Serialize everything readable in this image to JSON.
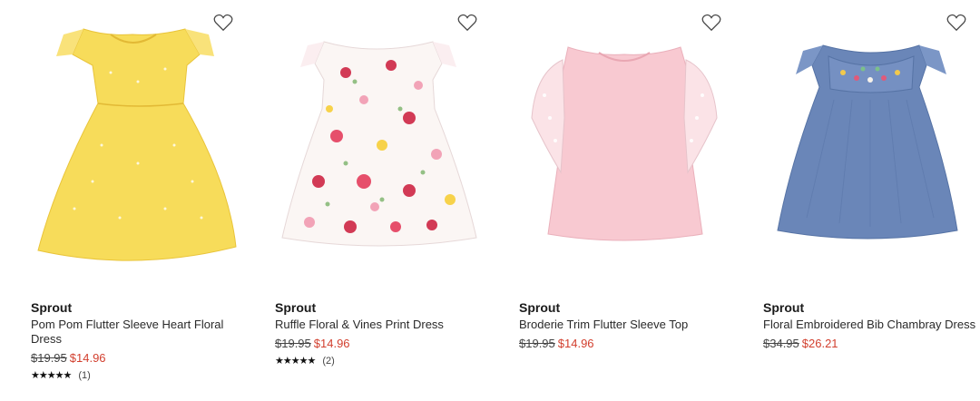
{
  "products": [
    {
      "brand": "Sprout",
      "title": "Pom Pom Flutter Sleeve Heart Floral Dress",
      "was_price": "$19.95",
      "sale_price": "$14.96",
      "stars": "★★★★★",
      "review_count": "(1)",
      "image_icon": "yellow-dress-icon"
    },
    {
      "brand": "Sprout",
      "title": "Ruffle Floral & Vines Print Dress",
      "was_price": "$19.95",
      "sale_price": "$14.96",
      "stars": "★★★★★",
      "review_count": "(2)",
      "image_icon": "floral-dress-icon"
    },
    {
      "brand": "Sprout",
      "title": "Broderie Trim Flutter Sleeve Top",
      "was_price": "$19.95",
      "sale_price": "$14.96",
      "image_icon": "pink-top-icon"
    },
    {
      "brand": "Sprout",
      "title": "Floral Embroidered Bib Chambray Dress",
      "was_price": "$34.95",
      "sale_price": "$26.21",
      "image_icon": "chambray-dress-icon"
    }
  ],
  "colors": {
    "sale": "#d2402f",
    "yellow_dress": "#f7dc5a",
    "pink_top": "#f8c9d1",
    "chambray": "#6a86b8"
  }
}
